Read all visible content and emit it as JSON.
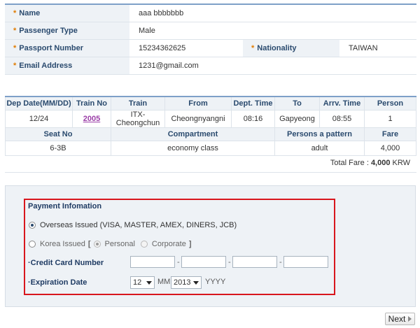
{
  "passenger": {
    "name_label": "Name",
    "name_value": "aaa bbbbbbb",
    "type_label": "Passenger Type",
    "type_value": "Male",
    "passport_label": "Passport Number",
    "passport_value": "15234362625",
    "nationality_label": "Nationality",
    "nationality_value": "TAIWAN",
    "email_label": "Email Address",
    "email_value": "1231@gmail.com",
    "required_mark": "*"
  },
  "train": {
    "headers": [
      "Dep Date(MM/DD)",
      "Train No",
      "Train",
      "From",
      "Dept. Time",
      "To",
      "Arrv. Time",
      "Person"
    ],
    "row": [
      "12/24",
      "2005",
      "ITX-Cheongchun",
      "Cheongnyangni",
      "08:16",
      "Gapyeong",
      "08:55",
      "1"
    ],
    "headers2": [
      "Seat No",
      "Compartment",
      "Persons a pattern",
      "Fare"
    ],
    "row2": [
      "6-3B",
      "economy class",
      "adult",
      "4,000"
    ]
  },
  "total": {
    "label": "Total Fare : ",
    "amount": "4,000",
    "currency": " KRW"
  },
  "payment": {
    "title": "Payment Infomation",
    "overseas_label": "Overseas Issued (VISA, MASTER, AMEX, DINERS, JCB)",
    "korea_label": "Korea Issued",
    "bracket_open": "[",
    "bracket_close": "]",
    "personal_label": "Personal",
    "corporate_label": "Corporate",
    "card_number_label": "Credit Card Number",
    "expiration_label": "Expiration Date",
    "month_value": "12",
    "month_unit": "MM",
    "year_value": "2013",
    "year_unit": "YYYY",
    "dash": "-",
    "bullet": "·"
  },
  "next_label": "Next",
  "colors": {
    "header_border": "#7ea0c8",
    "label_bg": "#eef2f6",
    "highlight_border": "#d8161d",
    "link": "#9b3fa8"
  }
}
